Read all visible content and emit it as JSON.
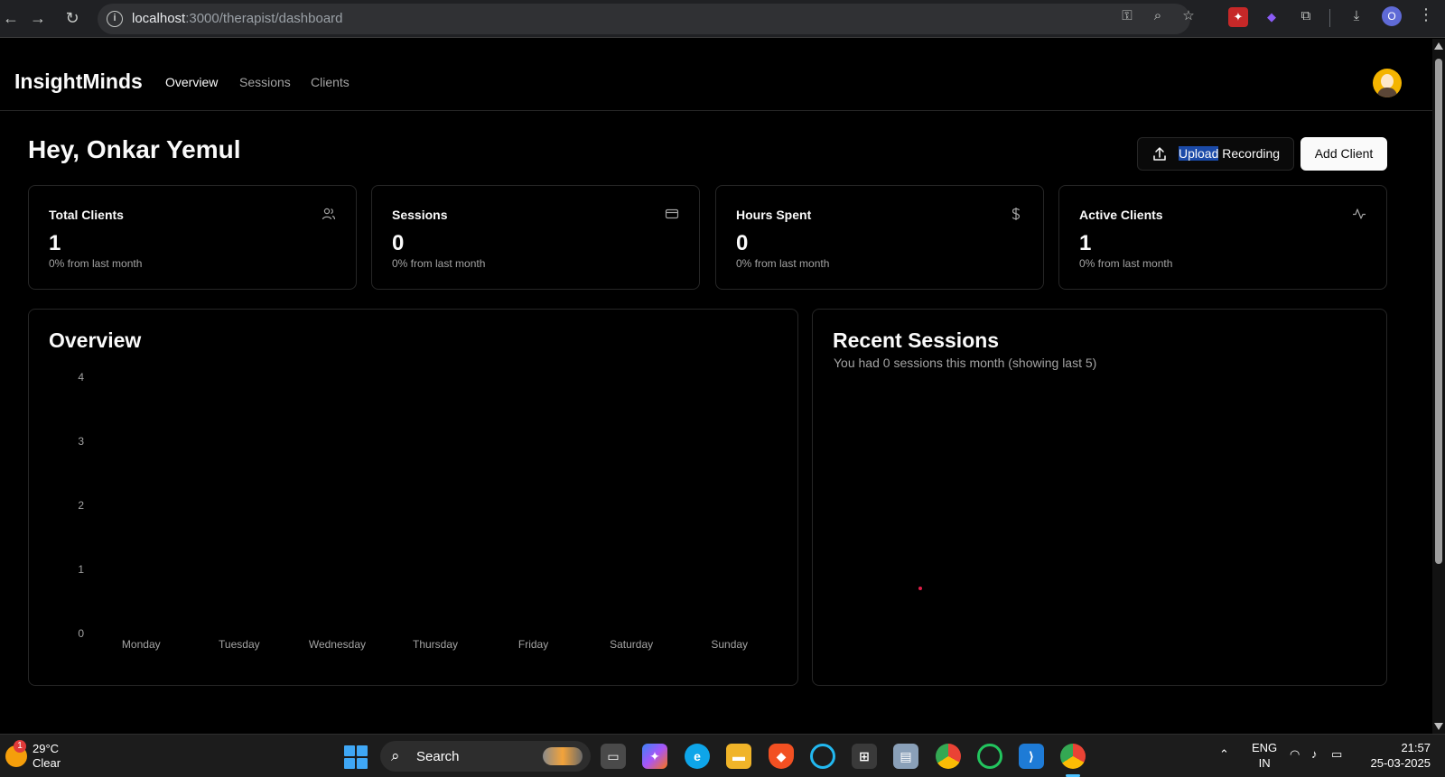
{
  "browser": {
    "url_host": "localhost",
    "url_path": ":3000/therapist/dashboard",
    "profile_initial": "O",
    "icons": [
      "back-icon",
      "forward-icon",
      "reload-icon",
      "site-info-icon",
      "password-key-icon",
      "zoom-icon",
      "bookmark-star-icon",
      "extension-red-icon",
      "extension-purple-icon",
      "extensions-puzzle-icon",
      "download-icon",
      "profile-icon",
      "menu-kebab-icon"
    ]
  },
  "nav": {
    "brand": "InsightMinds",
    "links": [
      "Overview",
      "Sessions",
      "Clients"
    ]
  },
  "header": {
    "greeting": "Hey, Onkar Yemul",
    "upload_highlight": "Upload",
    "upload_rest": " Recording",
    "add_client": "Add Client"
  },
  "stats": [
    {
      "title": "Total Clients",
      "value": "1",
      "sub": "0% from last month",
      "icon": "users-icon"
    },
    {
      "title": "Sessions",
      "value": "0",
      "sub": "0% from last month",
      "icon": "credit-card-icon"
    },
    {
      "title": "Hours Spent",
      "value": "0",
      "sub": "0% from last month",
      "icon": "dollar-icon"
    },
    {
      "title": "Active Clients",
      "value": "1",
      "sub": "0% from last month",
      "icon": "activity-icon"
    }
  ],
  "overview": {
    "title": "Overview"
  },
  "chart_data": {
    "type": "bar",
    "title": "Overview",
    "categories": [
      "Monday",
      "Tuesday",
      "Wednesday",
      "Thursday",
      "Friday",
      "Saturday",
      "Sunday"
    ],
    "values": [
      0,
      0,
      0,
      0,
      0,
      0,
      0
    ],
    "yticks": [
      0,
      1,
      2,
      3,
      4
    ],
    "ylim": [
      0,
      4
    ],
    "xlabel": "",
    "ylabel": "",
    "grid": false
  },
  "recent": {
    "title": "Recent Sessions",
    "desc": "You had 0 sessions this month (showing last 5)"
  },
  "taskbar": {
    "weather_badge": "1",
    "temp": "29°C",
    "condition": "Clear",
    "search": "Search",
    "lang_top": "ENG",
    "lang_bottom": "IN",
    "time": "21:57",
    "date": "25-03-2025",
    "chrome_badge": "0"
  },
  "colors": {
    "background": "#000000",
    "border": "#262626",
    "muted": "#a3a3a3",
    "foreground": "#fafafa",
    "highlight": "#1b4aa8"
  }
}
